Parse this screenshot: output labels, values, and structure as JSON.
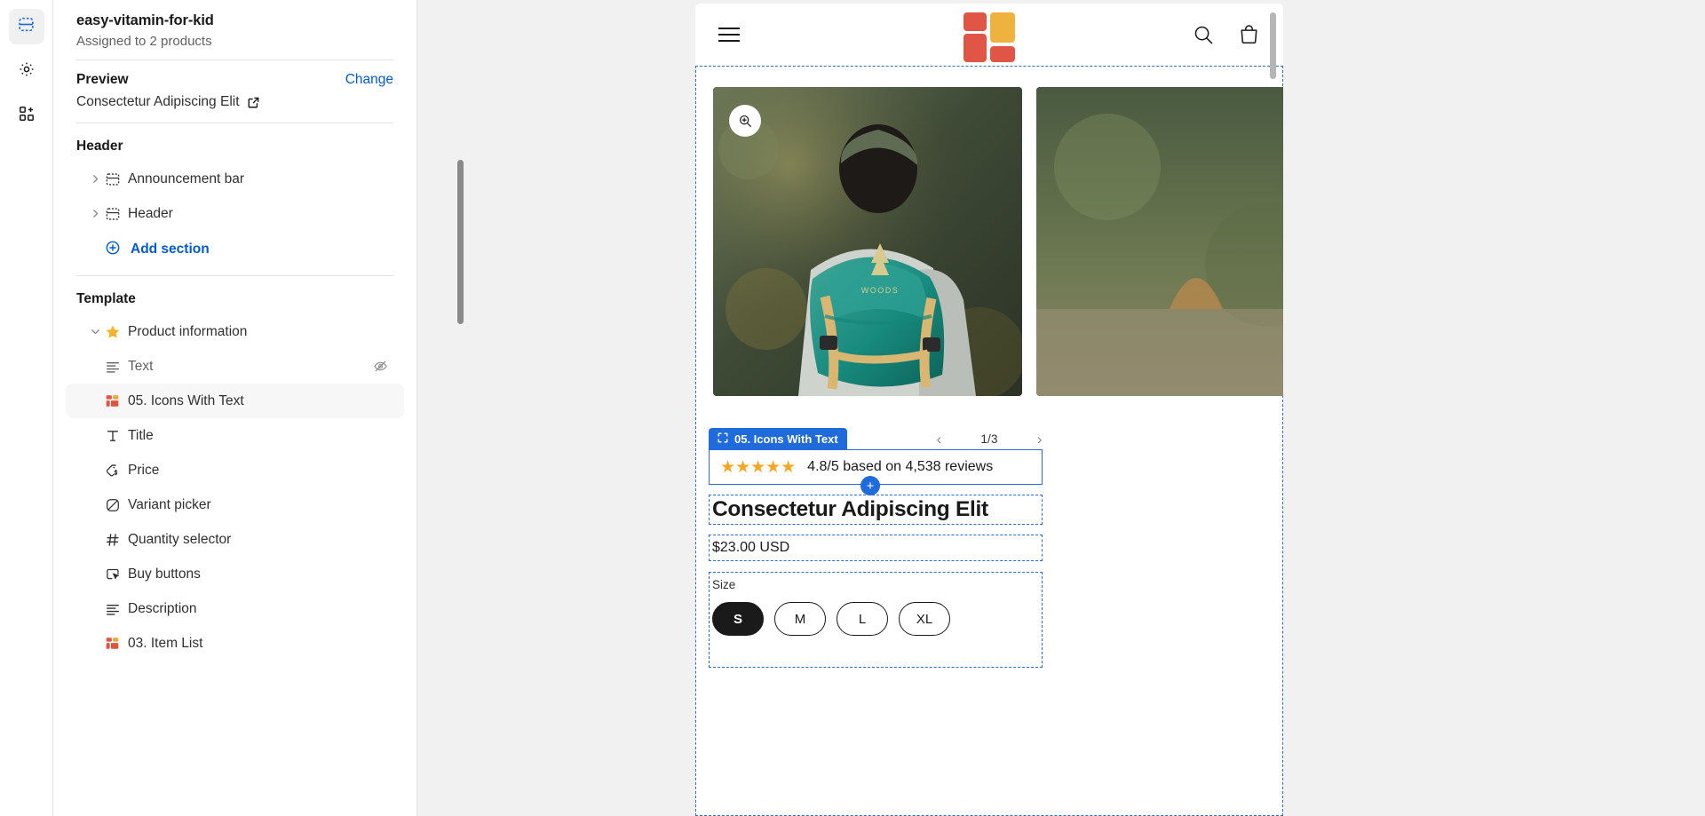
{
  "rail": {
    "items": [
      {
        "icon": "sections-icon",
        "name": "sections",
        "active": true
      },
      {
        "icon": "gear-icon",
        "name": "settings",
        "active": false
      },
      {
        "icon": "app-blocks-icon",
        "name": "apps",
        "active": false
      }
    ]
  },
  "sidebar": {
    "template_name": "easy-vitamin-for-kid",
    "assigned": "Assigned to 2 products",
    "preview_label": "Preview",
    "change_label": "Change",
    "preview_value": "Consectetur Adipiscing Elit",
    "header_group": {
      "title": "Header",
      "items": [
        {
          "label": "Announcement bar",
          "icon": "section-icon",
          "expandable": true
        },
        {
          "label": "Header",
          "icon": "section-icon",
          "expandable": true
        }
      ],
      "add_section": "Add section"
    },
    "template_group": {
      "title": "Template",
      "parent": {
        "label": "Product information",
        "icon": "star-icon",
        "expanded": true
      },
      "blocks": [
        {
          "label": "Text",
          "icon": "text-icon",
          "hidden": true,
          "selected": false
        },
        {
          "label": "05. Icons With Text",
          "icon": "app-block-icon",
          "hidden": false,
          "selected": true
        },
        {
          "label": "Title",
          "icon": "title-icon",
          "hidden": false,
          "selected": false
        },
        {
          "label": "Price",
          "icon": "price-tag-icon",
          "hidden": false,
          "selected": false
        },
        {
          "label": "Variant picker",
          "icon": "variant-icon",
          "hidden": false,
          "selected": false
        },
        {
          "label": "Quantity selector",
          "icon": "hash-icon",
          "hidden": false,
          "selected": false
        },
        {
          "label": "Buy buttons",
          "icon": "cursor-button-icon",
          "hidden": false,
          "selected": false
        },
        {
          "label": "Description",
          "icon": "text-icon",
          "hidden": false,
          "selected": false
        },
        {
          "label": "03. Item List",
          "icon": "app-block-icon",
          "hidden": false,
          "selected": false
        }
      ]
    }
  },
  "preview": {
    "store_header": {
      "menu_icon": "hamburger-icon",
      "search_icon": "search-icon",
      "cart_icon": "shopping-bag-icon",
      "logo": {
        "name": "store-logo",
        "color_primary": "#e05546",
        "color_secondary": "#f0b23f"
      }
    },
    "gallery": {
      "zoom_icon": "zoom-in-icon",
      "counter": "1/3",
      "prev_icon": "chevron-left-icon",
      "next_icon": "chevron-right-icon"
    },
    "selected_block": {
      "badge_label": "05. Icons With Text",
      "badge_icon": "block-frame-icon",
      "add_icon": "+"
    },
    "rating": {
      "stars": "★★★★★",
      "text": "4.8/5 based on 4,538 reviews"
    },
    "product": {
      "title": "Consectetur Adipiscing Elit",
      "price": "$23.00 USD",
      "size_label": "Size",
      "sizes": [
        {
          "label": "S",
          "selected": true
        },
        {
          "label": "M",
          "selected": false
        },
        {
          "label": "L",
          "selected": false
        },
        {
          "label": "XL",
          "selected": false
        }
      ]
    }
  },
  "colors": {
    "accent_blue": "#005bd3",
    "outline_blue": "#2b6cd4",
    "badge_blue": "#1f6bdb",
    "star_gold": "#f5a623"
  }
}
